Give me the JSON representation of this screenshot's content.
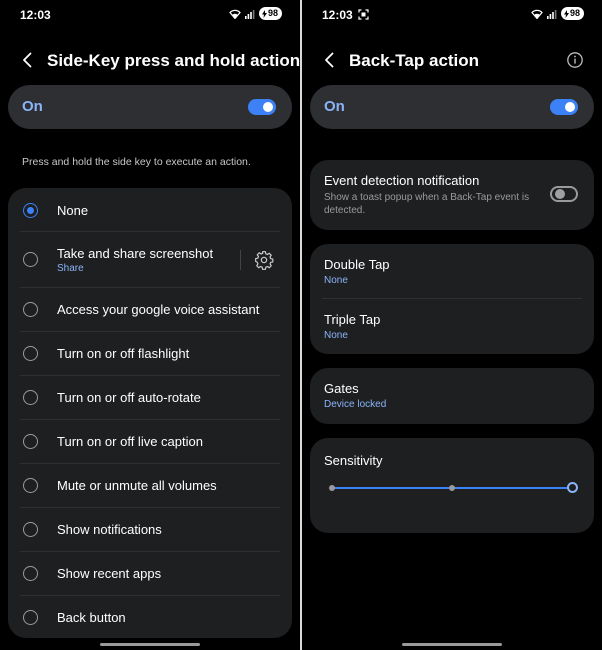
{
  "left": {
    "status": {
      "time": "12:03",
      "battery": "98"
    },
    "header": {
      "title": "Side-Key press and hold action"
    },
    "master_toggle": {
      "label": "On",
      "enabled": true
    },
    "description": "Press and hold the side key to execute an action.",
    "options": [
      {
        "label": "None",
        "selected": true
      },
      {
        "label": "Take and share screenshot",
        "sub": "Share",
        "selected": false
      },
      {
        "label": "Access your google voice assistant",
        "selected": false
      },
      {
        "label": "Turn on or off flashlight",
        "selected": false
      },
      {
        "label": "Turn on or off auto-rotate",
        "selected": false
      },
      {
        "label": "Turn on or off live caption",
        "selected": false
      },
      {
        "label": "Mute or unmute all volumes",
        "selected": false
      },
      {
        "label": "Show notifications",
        "selected": false
      },
      {
        "label": "Show recent apps",
        "selected": false
      },
      {
        "label": "Back button",
        "selected": false
      }
    ]
  },
  "right": {
    "status": {
      "time": "12:03",
      "battery": "98"
    },
    "header": {
      "title": "Back-Tap action"
    },
    "master_toggle": {
      "label": "On",
      "enabled": true
    },
    "event_detection": {
      "title": "Event detection notification",
      "subtitle": "Show a toast popup when a Back-Tap event is detected.",
      "enabled": false
    },
    "double_tap": {
      "title": "Double Tap",
      "value": "None"
    },
    "triple_tap": {
      "title": "Triple Tap",
      "value": "None"
    },
    "gates": {
      "title": "Gates",
      "value": "Device locked"
    },
    "sensitivity": {
      "title": "Sensitivity",
      "level_fraction": 1.0,
      "steps": 3
    }
  },
  "colors": {
    "accent": "#3c82f6",
    "link": "#8ab4f8",
    "card": "#1e1f21"
  }
}
